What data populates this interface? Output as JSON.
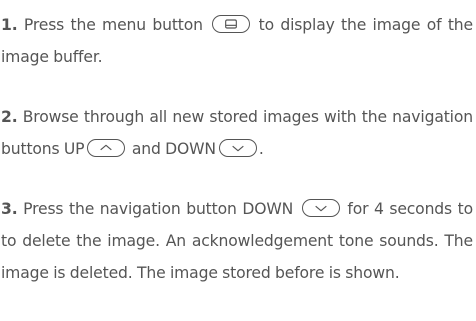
{
  "steps": [
    {
      "number": "1.",
      "text_a": "Press the menu button",
      "icon_a": "menu-button-icon",
      "text_b": "to display the image of the image buffer."
    },
    {
      "number": "2.",
      "text_a": "Browse through all new stored images with the navigation buttons UP",
      "icon_a": "up-button-icon",
      "text_b": "and DOWN",
      "icon_b": "down-button-icon",
      "text_c": "."
    },
    {
      "number": "3.",
      "text_a": "Press the navigation button DOWN",
      "icon_a": "down-button-icon",
      "text_b": "for 4 seconds to to delete the image. An acknowledgement tone sounds. The image is deleted. The image stored before is shown."
    }
  ],
  "colors": {
    "text": "#555555",
    "background": "#ffffff"
  }
}
